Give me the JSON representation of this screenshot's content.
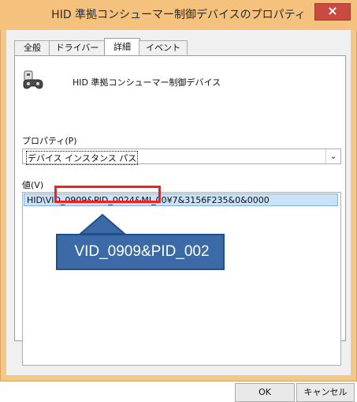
{
  "window": {
    "title": "HID 準拠コンシューマー制御デバイスのプロパティ",
    "close_glyph": "×",
    "frame_color": "#f2c98a",
    "close_color": "#c94a41"
  },
  "tabs": [
    {
      "label": "全般"
    },
    {
      "label": "ドライバー"
    },
    {
      "label": "詳細",
      "active": true
    },
    {
      "label": "イベント"
    }
  ],
  "device": {
    "name": "HID 準拠コンシューマー制御デバイス",
    "icon": "gamepad-icon"
  },
  "property": {
    "label": "プロパティ(P)",
    "selected": "デバイス インスタンス パス"
  },
  "value": {
    "label": "値(V)",
    "items": [
      "HID\\VID_0909&PID_0024&MI_00¥7&3156F235&0&0000"
    ]
  },
  "annotation": {
    "text": "VID_0909&PID_002",
    "accent": "#3c6aa6",
    "highlight": "#ff1b1b"
  },
  "buttons": {
    "ok": "OK",
    "cancel": "キャンセル"
  }
}
